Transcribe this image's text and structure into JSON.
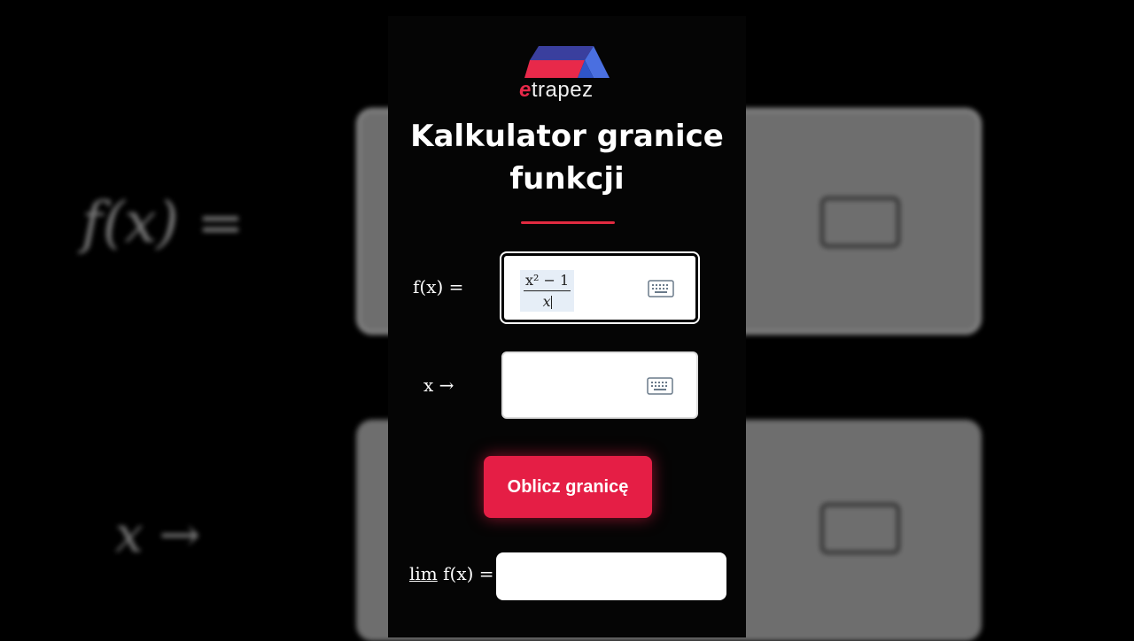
{
  "brand": {
    "logo_prefix": "e",
    "logo_rest": "trapez"
  },
  "page_title": "Kalkulator granice funkcji",
  "function_input": {
    "label": "f(x) =",
    "numerator": "x² − 1",
    "denominator": "x"
  },
  "approach_input": {
    "label": "x →",
    "value": ""
  },
  "calculate_button": {
    "label": "Oblicz granicę"
  },
  "result": {
    "label_lim": "lim",
    "label_rest": "f(x) =",
    "value": ""
  },
  "background_echo": {
    "fx_label": "f(x) =",
    "x_label": "x →"
  },
  "colors": {
    "accent": "#e51e45",
    "logo_blue": "#3b5bd9",
    "logo_red": "#e8294a"
  },
  "icons": [
    "keyboard-icon"
  ]
}
